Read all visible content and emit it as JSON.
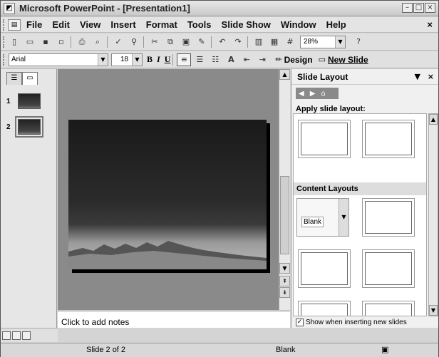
{
  "window": {
    "title": "Microsoft PowerPoint - [Presentation1]",
    "controls": [
      "minimize",
      "maximize",
      "close"
    ]
  },
  "menu": {
    "items": [
      "File",
      "Edit",
      "View",
      "Insert",
      "Format",
      "Tools",
      "Slide Show",
      "Window",
      "Help"
    ],
    "close_glyph": "×"
  },
  "toolbar": {
    "zoom": "28%"
  },
  "formatting": {
    "font": "Arial",
    "size": "18",
    "bold": "B",
    "italic": "I",
    "underline": "U",
    "design": "Design",
    "new_slide": "New Slide"
  },
  "slides": {
    "thumbnails": [
      {
        "number": "1"
      },
      {
        "number": "2"
      }
    ]
  },
  "notes": {
    "placeholder": "Click to add notes"
  },
  "task_pane": {
    "title": "Slide Layout",
    "apply_label": "Apply slide layout:",
    "section": "Content Layouts",
    "blank_label": "Blank",
    "show_checkbox": "Show when inserting new slides"
  },
  "status": {
    "slide_position": "Slide 2 of 2",
    "design": "Blank"
  }
}
